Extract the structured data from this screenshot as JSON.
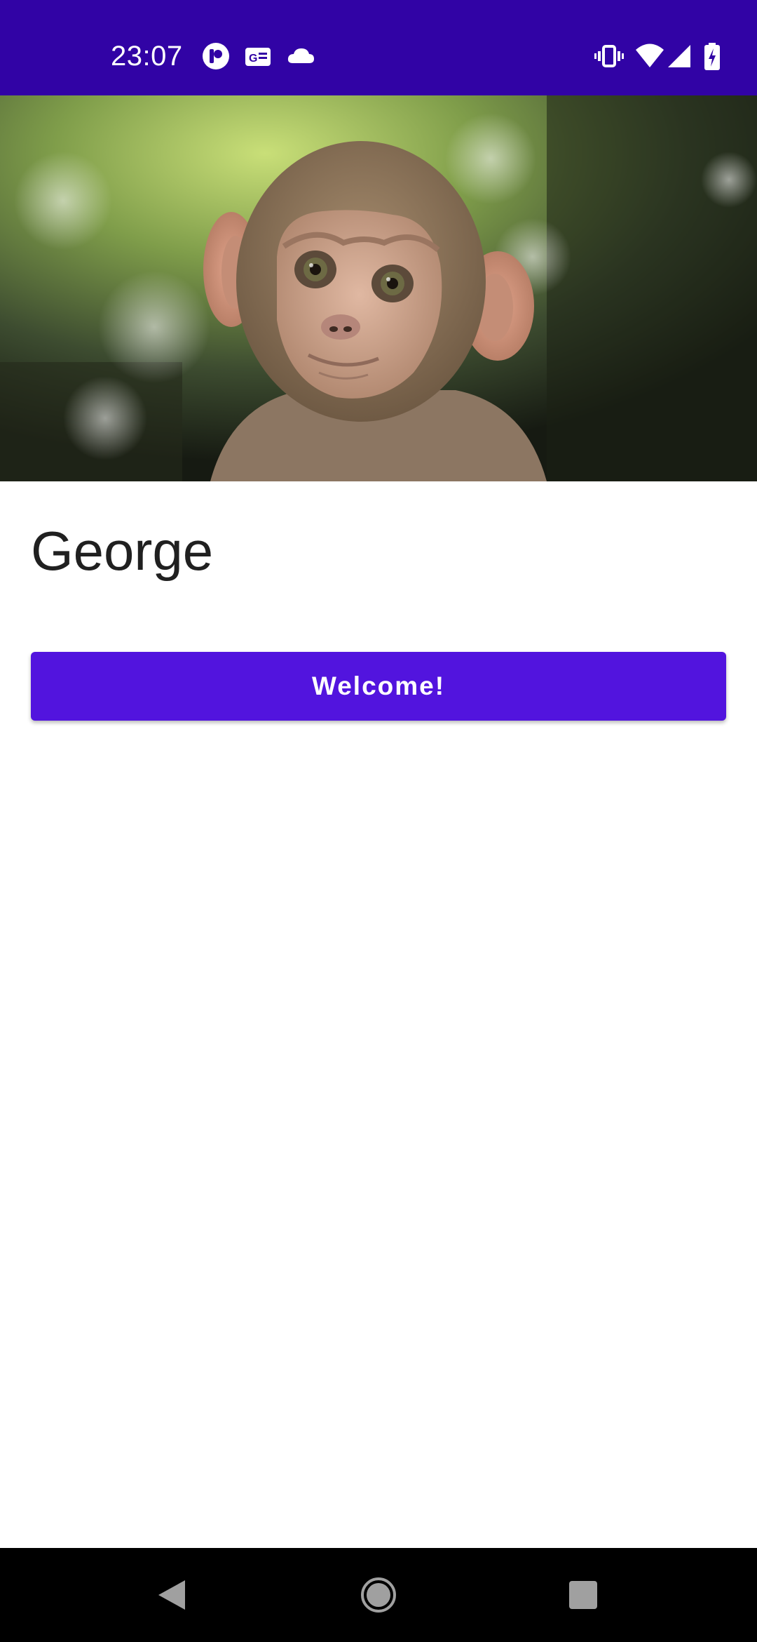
{
  "status_bar": {
    "time": "23:07",
    "background_color": "#3103a5",
    "left_icons": [
      "notification-app-icon",
      "news-icon",
      "cloud-icon"
    ],
    "right_icons": [
      "vibrate-icon",
      "wifi-icon",
      "signal-icon",
      "battery-charging-icon"
    ]
  },
  "hero": {
    "image": "monkey-photo"
  },
  "profile": {
    "name": "George"
  },
  "actions": {
    "welcome_label": "Welcome!",
    "accent_color": "#5214de"
  },
  "nav_bar": {
    "buttons": [
      "back-icon",
      "home-icon",
      "recents-icon"
    ]
  }
}
